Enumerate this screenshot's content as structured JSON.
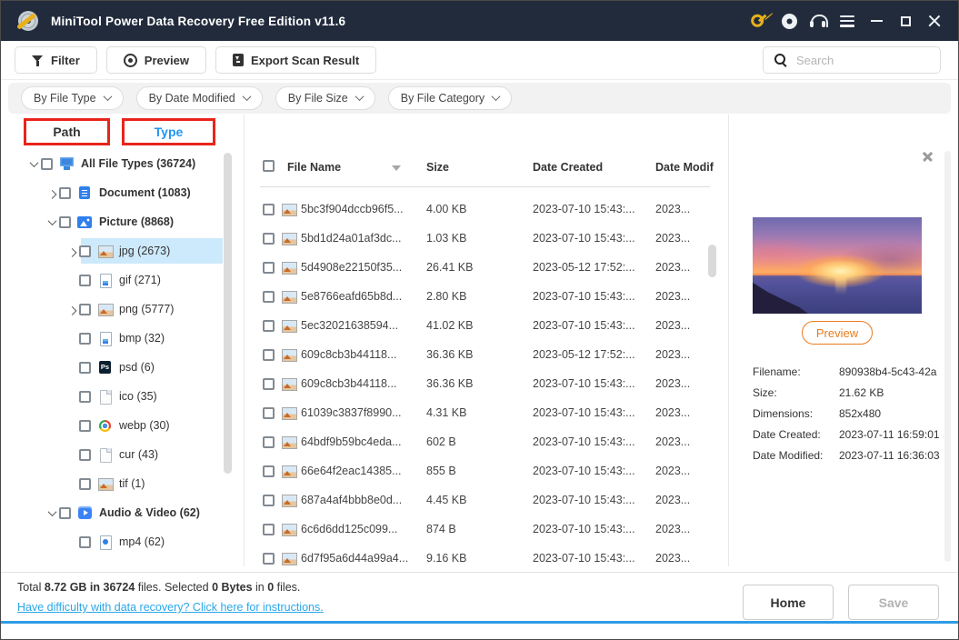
{
  "window": {
    "title": "MiniTool Power Data Recovery Free Edition v11.6",
    "titlebar_icons": [
      "app-icon",
      "key-icon",
      "disc-icon",
      "headset-icon",
      "menu-icon",
      "minimize-icon",
      "maximize-icon",
      "close-icon"
    ]
  },
  "toolbar": {
    "filter_label": "Filter",
    "preview_label": "Preview",
    "export_label": "Export Scan Result",
    "search_placeholder": "Search"
  },
  "filter_dropdowns": [
    "By File Type",
    "By Date Modified",
    "By File Size",
    "By File Category"
  ],
  "sidebar": {
    "tabs": [
      {
        "label": "Path",
        "active": false
      },
      {
        "label": "Type",
        "active": true
      }
    ],
    "tab_highlight_color": "#e8251c",
    "active_tab_color": "#2196f3",
    "tree": [
      {
        "label": "All File Types (36724)",
        "level": 0,
        "expander": "down",
        "icon": "monitor",
        "bold": true,
        "selected": false
      },
      {
        "label": "Document (1083)",
        "level": 1,
        "expander": "right",
        "icon": "doc",
        "bold": true,
        "selected": false
      },
      {
        "label": "Picture (8868)",
        "level": 1,
        "expander": "down",
        "icon": "pic",
        "bold": true,
        "selected": false
      },
      {
        "label": "jpg (2673)",
        "level": 2,
        "expander": "right",
        "icon": "photo",
        "bold": false,
        "selected": true
      },
      {
        "label": "gif (271)",
        "level": 2,
        "expander": "none",
        "icon": "gif",
        "bold": false,
        "selected": false
      },
      {
        "label": "png (5777)",
        "level": 2,
        "expander": "right",
        "icon": "photo",
        "bold": false,
        "selected": false
      },
      {
        "label": "bmp (32)",
        "level": 2,
        "expander": "none",
        "icon": "gif",
        "bold": false,
        "selected": false
      },
      {
        "label": "psd (6)",
        "level": 2,
        "expander": "none",
        "icon": "psd",
        "bold": false,
        "selected": false
      },
      {
        "label": "ico (35)",
        "level": 2,
        "expander": "none",
        "icon": "file",
        "bold": false,
        "selected": false
      },
      {
        "label": "webp (30)",
        "level": 2,
        "expander": "none",
        "icon": "webp",
        "bold": false,
        "selected": false
      },
      {
        "label": "cur (43)",
        "level": 2,
        "expander": "none",
        "icon": "file",
        "bold": false,
        "selected": false
      },
      {
        "label": "tif (1)",
        "level": 2,
        "expander": "none",
        "icon": "photo",
        "bold": false,
        "selected": false
      },
      {
        "label": "Audio & Video (62)",
        "level": 1,
        "expander": "down",
        "icon": "video",
        "bold": true,
        "selected": false
      },
      {
        "label": "mp4 (62)",
        "level": 2,
        "expander": "none",
        "icon": "mp4",
        "bold": false,
        "selected": false
      }
    ]
  },
  "table": {
    "columns": [
      "File Name",
      "Size",
      "Date Created",
      "Date Modif"
    ],
    "rows": [
      {
        "name": "5bc3f904dccb96f5...",
        "size": "4.00 KB",
        "created": "2023-07-10 15:43:...",
        "modified": "2023..."
      },
      {
        "name": "5bd1d24a01af3dc...",
        "size": "1.03 KB",
        "created": "2023-07-10 15:43:...",
        "modified": "2023..."
      },
      {
        "name": "5d4908e22150f35...",
        "size": "26.41 KB",
        "created": "2023-05-12 17:52:...",
        "modified": "2023..."
      },
      {
        "name": "5e8766eafd65b8d...",
        "size": "2.80 KB",
        "created": "2023-07-10 15:43:...",
        "modified": "2023..."
      },
      {
        "name": "5ec32021638594...",
        "size": "41.02 KB",
        "created": "2023-07-10 15:43:...",
        "modified": "2023..."
      },
      {
        "name": "609c8cb3b44118...",
        "size": "36.36 KB",
        "created": "2023-05-12 17:52:...",
        "modified": "2023..."
      },
      {
        "name": "609c8cb3b44118...",
        "size": "36.36 KB",
        "created": "2023-07-10 15:43:...",
        "modified": "2023..."
      },
      {
        "name": "61039c3837f8990...",
        "size": "4.31 KB",
        "created": "2023-07-10 15:43:...",
        "modified": "2023..."
      },
      {
        "name": "64bdf9b59bc4eda...",
        "size": "602 B",
        "created": "2023-07-10 15:43:...",
        "modified": "2023..."
      },
      {
        "name": "66e64f2eac14385...",
        "size": "855 B",
        "created": "2023-07-10 15:43:...",
        "modified": "2023..."
      },
      {
        "name": "687a4af4bbb8e0d...",
        "size": "4.45 KB",
        "created": "2023-07-10 15:43:...",
        "modified": "2023..."
      },
      {
        "name": "6c6d6dd125c099...",
        "size": "874 B",
        "created": "2023-07-10 15:43:...",
        "modified": "2023..."
      },
      {
        "name": "6d7f95a6d44a99a4...",
        "size": "9.16 KB",
        "created": "2023-07-10 15:43:...",
        "modified": "2023..."
      }
    ]
  },
  "preview_panel": {
    "image_name": "sunset-preview-image",
    "preview_button_label": "Preview",
    "accent_color": "#e87c1e",
    "details": [
      {
        "label": "Filename:",
        "value": "890938b4-5c43-42a"
      },
      {
        "label": "Size:",
        "value": "21.62 KB"
      },
      {
        "label": "Dimensions:",
        "value": "852x480"
      },
      {
        "label": "Date Created:",
        "value": "2023-07-11 16:59:01"
      },
      {
        "label": "Date Modified:",
        "value": "2023-07-11 16:36:03"
      }
    ]
  },
  "statusbar": {
    "summary_segments": [
      {
        "text": "Total ",
        "bold": false
      },
      {
        "text": "8.72",
        "bold": true
      },
      {
        "text": " GB in ",
        "bold": true
      },
      {
        "text": "36724",
        "bold": true
      },
      {
        "text": " files.  ",
        "bold": false
      },
      {
        "text": "Selected ",
        "bold": false
      },
      {
        "text": "0 Bytes",
        "bold": true
      },
      {
        "text": " in ",
        "bold": false
      },
      {
        "text": "0",
        "bold": true
      },
      {
        "text": " files.",
        "bold": false
      }
    ],
    "help_link": "Have difficulty with data recovery? Click here for instructions.",
    "home_button": "Home",
    "save_button": "Save"
  },
  "colors": {
    "titlebar_bg": "#212b3c",
    "selected_row_bg": "#cde9fc",
    "bottom_accent": "#2e9be5",
    "link_blue": "#2ba7e8"
  }
}
